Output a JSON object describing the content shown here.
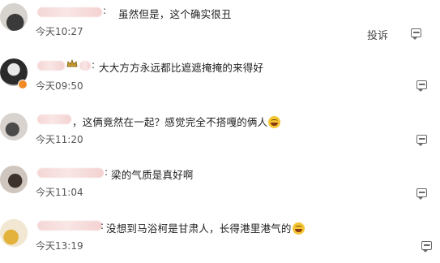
{
  "comments": [
    {
      "text": "虽然但是，这个确实很丑",
      "time": "今天10:27",
      "report": "投诉",
      "has_emoji": false
    },
    {
      "text": "大大方方永远都比遮遮掩掩的来得好",
      "time": "今天09:50",
      "has_emoji": false
    },
    {
      "text": "，这俩竟然在一起？感觉完全不搭嘎的俩人",
      "time": "今天11:20",
      "has_emoji": true
    },
    {
      "text": "梁的气质是真好啊",
      "time": "今天11:04",
      "has_emoji": false
    },
    {
      "text": "没想到马浴柯是甘肃人，长得港里港气的",
      "time": "今天13:19",
      "has_emoji": true
    }
  ],
  "icons": {
    "reply": "comment-bubble-icon",
    "emoji": "laughing-emoji-icon",
    "vip": "crown-icon",
    "verified": "v-badge-icon"
  },
  "colors": {
    "name_blur": "#f4d7d6",
    "text": "#222222",
    "time": "#555555",
    "icon": "#6a6a6a"
  }
}
